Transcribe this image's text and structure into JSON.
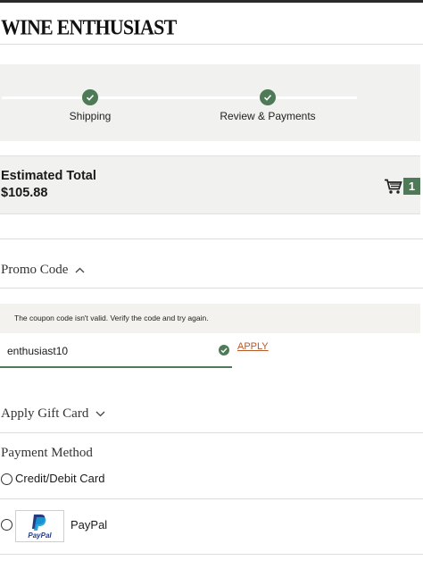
{
  "header": {
    "logo_text": "Wine Enthusiast"
  },
  "progress": {
    "steps": [
      {
        "label": "Shipping",
        "icon": "check-icon"
      },
      {
        "label": "Review & Payments",
        "icon": "check-icon"
      }
    ]
  },
  "summary": {
    "label": "Estimated Total",
    "amount": "$105.88",
    "cart_icon": "cart-icon",
    "cart_count": "1"
  },
  "promo": {
    "title": "Promo Code",
    "toggle_icon": "chevron-up-icon",
    "error_message": "The coupon code isn't valid. Verify the code and try again.",
    "input_value": "enthusiast10",
    "apply_label": "APPLY"
  },
  "gift_card": {
    "title": "Apply Gift Card",
    "toggle_icon": "chevron-down-icon"
  },
  "payment": {
    "title": "Payment Method",
    "options": [
      {
        "label": "Credit/Debit Card"
      },
      {
        "label": "PayPal",
        "logo_text": "PayPal"
      }
    ]
  },
  "colors": {
    "accent_green": "#4e7a57",
    "link_orange": "#b45a2b",
    "panel_bg": "#f1f1f0"
  }
}
